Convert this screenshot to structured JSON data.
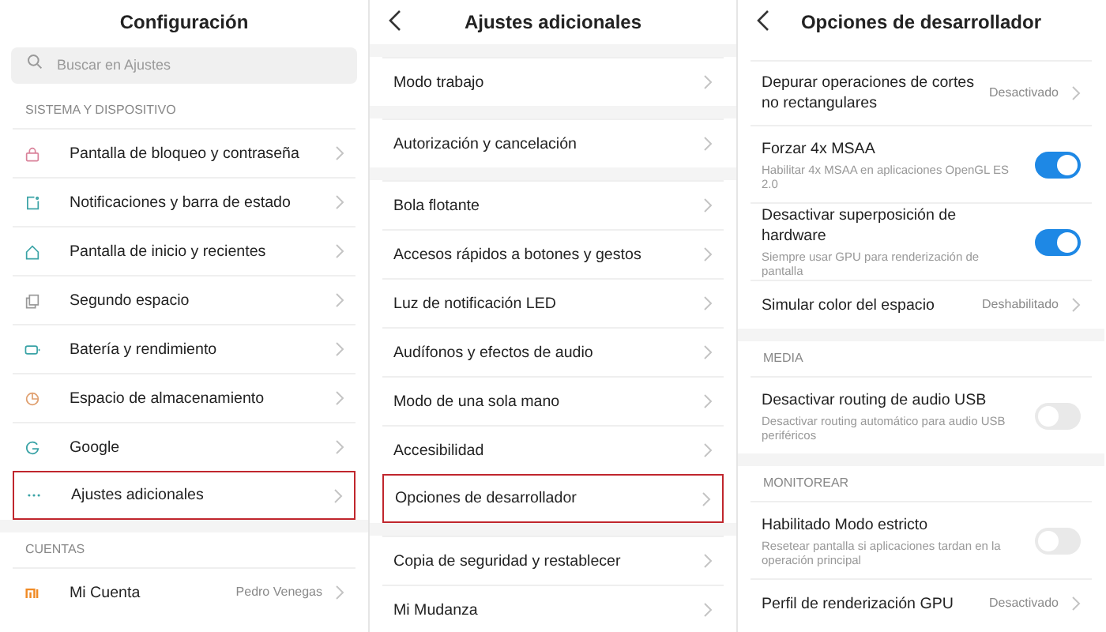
{
  "panels": [
    {
      "title": "Configuración",
      "back": false,
      "search": {
        "placeholder": "Buscar en Ajustes"
      },
      "groups": [
        {
          "header": "SISTEMA Y DISPOSITIVO",
          "items": [
            {
              "kind": "nav",
              "label": "Pantalla de bloqueo y contraseña",
              "highlighted": false
            },
            {
              "kind": "nav",
              "label": "Notificaciones y barra de estado",
              "highlighted": false
            },
            {
              "kind": "nav",
              "label": "Pantalla de inicio y recientes",
              "highlighted": false
            },
            {
              "kind": "nav",
              "label": "Segundo espacio",
              "highlighted": false
            },
            {
              "kind": "nav",
              "label": "Batería y rendimiento",
              "highlighted": false
            },
            {
              "kind": "nav",
              "label": "Espacio de almacenamiento",
              "highlighted": false
            },
            {
              "kind": "nav",
              "label": "Google",
              "highlighted": false
            },
            {
              "kind": "nav",
              "label": "Ajustes adicionales",
              "highlighted": true
            }
          ]
        },
        {
          "header": "CUENTAS",
          "items": [
            {
              "kind": "nav",
              "label": "Mi Cuenta",
              "value": "Pedro Venegas",
              "highlighted": false
            }
          ]
        }
      ]
    },
    {
      "title": "Ajustes adicionales",
      "back": true,
      "groups": [
        {
          "items": [
            {
              "kind": "nav",
              "label": "Modo trabajo",
              "highlighted": false
            }
          ]
        },
        {
          "items": [
            {
              "kind": "nav",
              "label": "Autorización y cancelación",
              "highlighted": false
            }
          ]
        },
        {
          "items": [
            {
              "kind": "nav",
              "label": "Bola flotante",
              "highlighted": false
            },
            {
              "kind": "nav",
              "label": "Accesos rápidos a botones y gestos",
              "highlighted": false
            },
            {
              "kind": "nav",
              "label": "Luz de notificación LED",
              "highlighted": false
            },
            {
              "kind": "nav",
              "label": "Audífonos y efectos de audio",
              "highlighted": false
            },
            {
              "kind": "nav",
              "label": "Modo de una sola mano",
              "highlighted": false
            },
            {
              "kind": "nav",
              "label": "Accesibilidad",
              "highlighted": false
            },
            {
              "kind": "nav",
              "label": "Opciones de desarrollador",
              "highlighted": true
            }
          ]
        },
        {
          "items": [
            {
              "kind": "nav",
              "label": "Copia de seguridad y restablecer",
              "highlighted": false
            },
            {
              "kind": "nav",
              "label": "Mi Mudanza",
              "highlighted": false
            }
          ]
        }
      ]
    },
    {
      "title": "Opciones de desarrollador",
      "back": true,
      "groups": [
        {
          "items": [
            {
              "kind": "nav",
              "label": "Depurar operaciones de cortes no rectangulares",
              "value": "Desactivado"
            },
            {
              "kind": "toggle",
              "label": "Forzar 4x MSAA",
              "description": "Habilitar 4x MSAA en aplicaciones OpenGL ES 2.0",
              "on": true
            },
            {
              "kind": "toggle",
              "label": "Desactivar superposición de hardware",
              "description": "Siempre usar GPU para renderización de pantalla",
              "on": true
            },
            {
              "kind": "nav",
              "label": "Simular color del espacio",
              "value": "Deshabilitado"
            }
          ]
        },
        {
          "header": "MEDIA",
          "items": [
            {
              "kind": "toggle",
              "label": "Desactivar routing de audio USB",
              "description": "Desactivar routing automático para audio USB periféricos",
              "on": false
            }
          ]
        },
        {
          "header": "MONITOREAR",
          "items": [
            {
              "kind": "toggle",
              "label": "Habilitado Modo estricto",
              "description": "Resetear pantalla si aplicaciones tardan en la operación principal",
              "on": false
            },
            {
              "kind": "nav",
              "label": "Perfil de renderización GPU",
              "value": "Desactivado"
            }
          ]
        }
      ]
    }
  ]
}
